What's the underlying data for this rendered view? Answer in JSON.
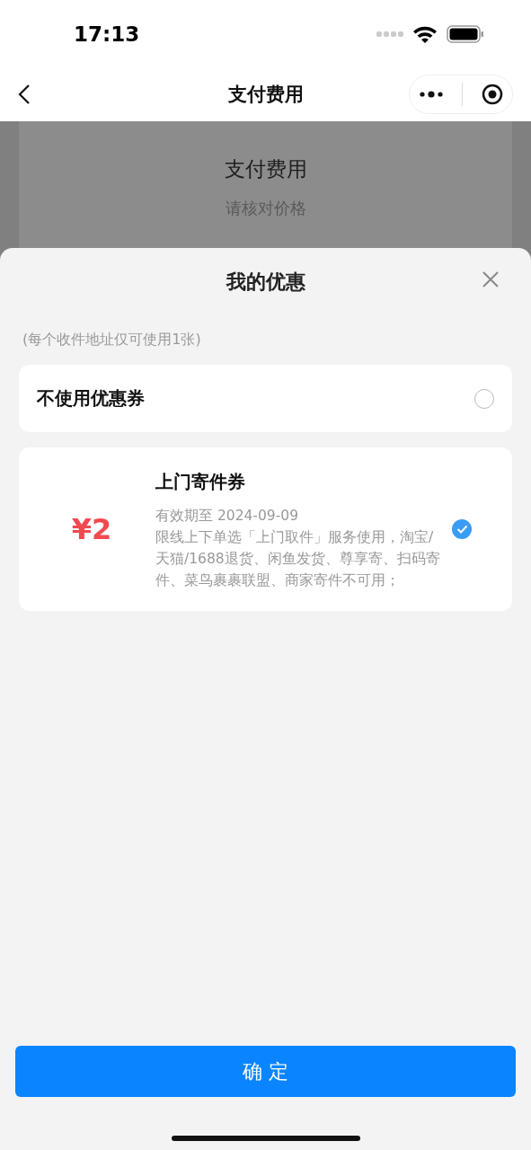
{
  "status_bar": {
    "time": "17:13"
  },
  "nav": {
    "title": "支付费用"
  },
  "background_page": {
    "title": "支付费用",
    "subtitle": "请核对价格"
  },
  "sheet": {
    "title": "我的优惠",
    "note": "(每个收件地址仅可使用1张)",
    "options": [
      {
        "kind": "none",
        "label": "不使用优惠券",
        "selected": false
      },
      {
        "kind": "coupon",
        "amount": "¥2",
        "title": "上门寄件券",
        "validity": "有效期至 2024-09-09",
        "description": "限线上下单选「上门取件」服务使用，淘宝/天猫/1688退货、闲鱼发货、尊享寄、扫码寄件、菜鸟裹裹联盟、商家寄件不可用；",
        "selected": true
      }
    ],
    "confirm": "确 定"
  }
}
